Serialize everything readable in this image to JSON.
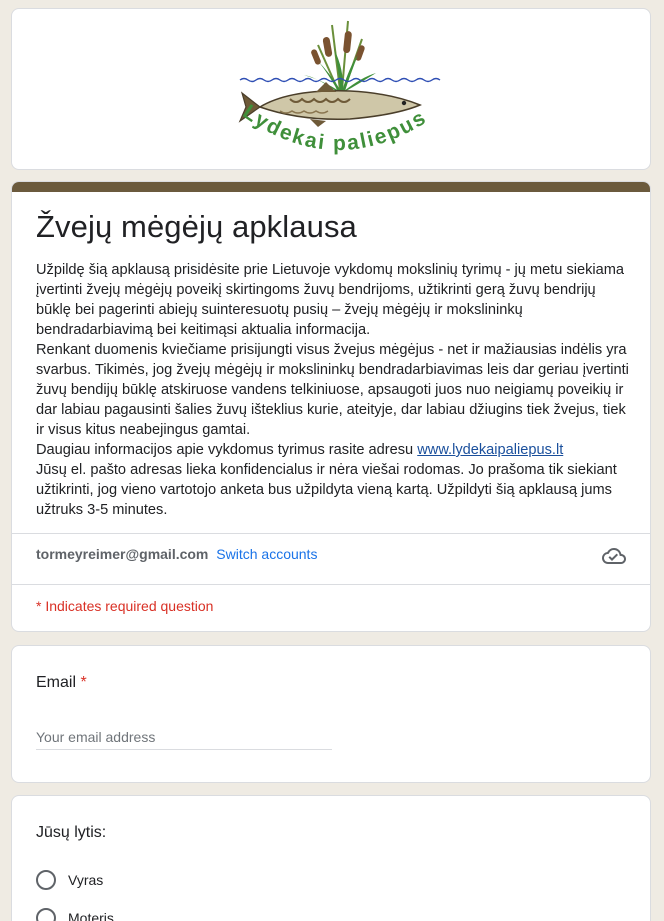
{
  "logo": {
    "text": "Lydekai paliepus"
  },
  "form": {
    "title": "Žvejų mėgėjų apklausa",
    "description_p1": "Užpildę šią apklausą prisidėsite prie Lietuvoje vykdomų mokslinių tyrimų - jų metu siekiama įvertinti žvejų mėgėjų poveikį skirtingoms žuvų bendrijoms, užtikrinti gerą žuvų bendrijų būklę bei pagerinti abiejų suinteresuotų pusių – žvejų mėgėjų ir mokslininkų bendradarbiavimą bei keitimąsi aktualia informacija.",
    "description_p2": "Renkant duomenis kviečiame prisijungti visus žvejus mėgėjus - net ir mažiausias indėlis yra svarbus. Tikimės, jog žvejų mėgėjų ir mokslininkų bendradarbiavimas leis dar geriau įvertinti žuvų bendijų būklę atskiruose vandens telkiniuose, apsaugoti juos nuo neigiamų poveikių ir dar labiau pagausinti šalies žuvų išteklius kurie, ateityje, dar labiau džiugins tiek žvejus, tiek ir visus kitus neabejingus gamtai.",
    "description_p3_text": "Daugiau informacijos apie vykdomus tyrimus rasite adresu ",
    "description_p3_link": "www.lydekaipaliepus.lt",
    "description_p4": "Jūsų el. pašto adresas lieka konfidencialus ir nėra viešai rodomas. Jo prašoma tik siekiant užtikrinti, jog vieno vartotojo anketa bus užpildyta vieną kartą. Užpildyti šią apklausą jums užtruks 3-5 minutes."
  },
  "account": {
    "email": "tormeyreimer@gmail.com",
    "switch_label": "Switch accounts",
    "icon": "cloud-check-icon"
  },
  "required_note": "* Indicates required question",
  "email_question": {
    "label": "Email",
    "required_mark": "*",
    "placeholder": "Your email address",
    "value": ""
  },
  "gender_question": {
    "label": "Jūsų lytis:",
    "options": [
      "Vyras",
      "Moteris"
    ]
  },
  "colors": {
    "accent_strip": "#6b5a3d",
    "background": "#efebe3",
    "link": "#1a73e8",
    "required": "#d93025"
  }
}
